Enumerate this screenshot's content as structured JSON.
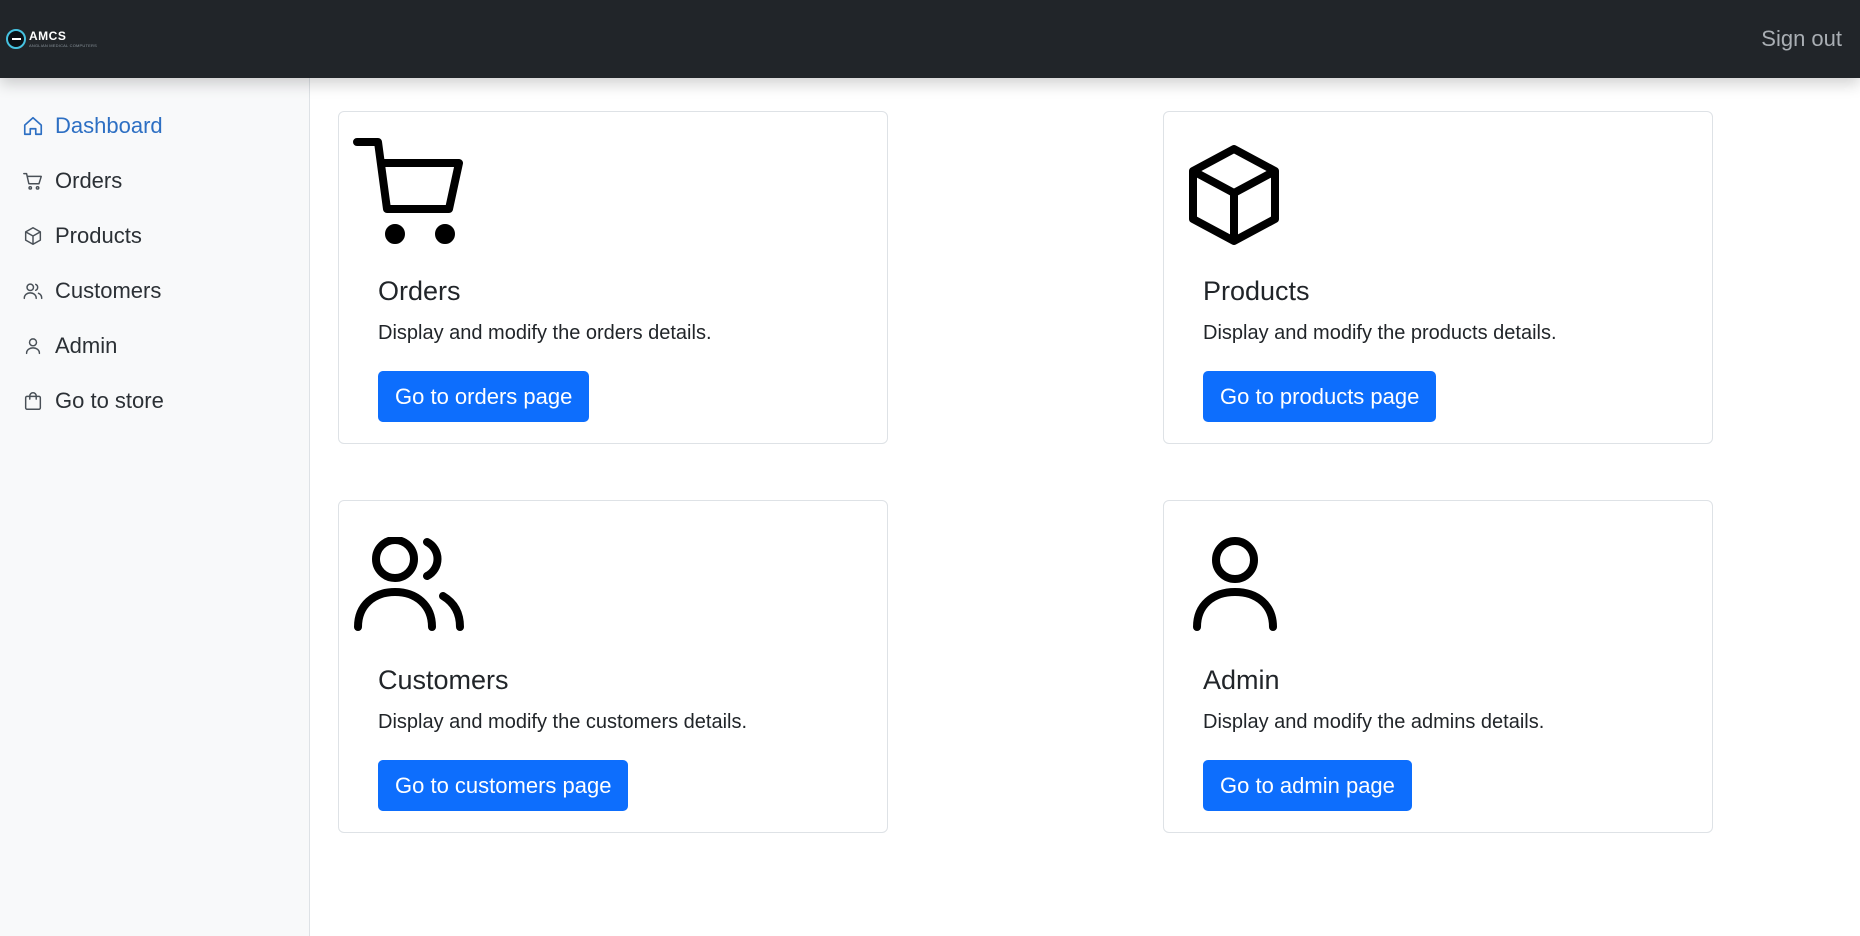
{
  "header": {
    "brand": {
      "name": "AMCS",
      "tagline": "ANGLIAN MEDICAL COMPUTERS"
    },
    "sign_out_label": "Sign out"
  },
  "sidebar": {
    "items": [
      {
        "label": "Dashboard",
        "icon": "house-icon",
        "active": true
      },
      {
        "label": "Orders",
        "icon": "cart-icon"
      },
      {
        "label": "Products",
        "icon": "box-icon"
      },
      {
        "label": "Customers",
        "icon": "people-icon"
      },
      {
        "label": "Admin",
        "icon": "person-icon"
      },
      {
        "label": "Go to store",
        "icon": "bag-icon"
      }
    ]
  },
  "cards": [
    {
      "title": "Orders",
      "text": "Display and modify the orders details.",
      "button": "Go to orders page",
      "icon": "cart-icon"
    },
    {
      "title": "Products",
      "text": "Display and modify the products details.",
      "button": "Go to products page",
      "icon": "box-icon"
    },
    {
      "title": "Customers",
      "text": "Display and modify the customers details.",
      "button": "Go to customers page",
      "icon": "people-icon"
    },
    {
      "title": "Admin",
      "text": "Display and modify the admins details.",
      "button": "Go to admin page",
      "icon": "person-icon"
    }
  ],
  "colors": {
    "topbar": "#212529",
    "accent": "#0d6efd",
    "active_nav": "#2d6fc3"
  }
}
